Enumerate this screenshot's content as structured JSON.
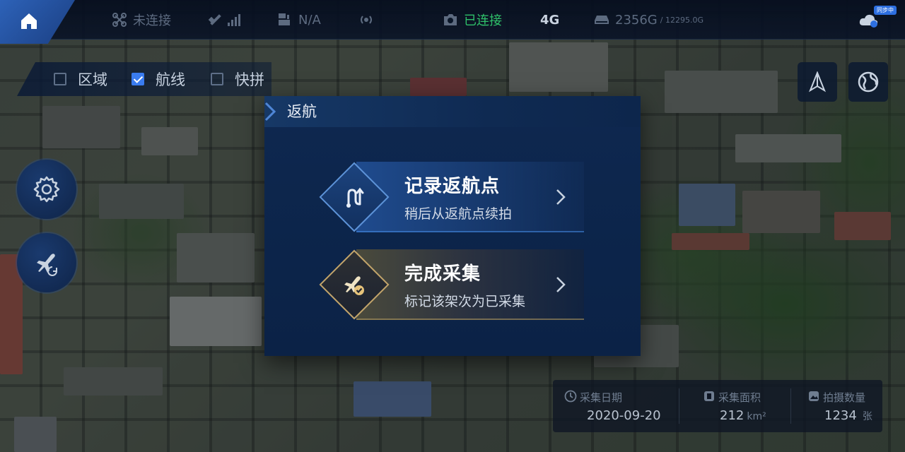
{
  "topbar": {
    "drone_status": "未连接",
    "rtk_status": "N/A",
    "camera_status": "已连接",
    "network": "4G",
    "storage_used": "2356G",
    "storage_total": "/ 12295.0G",
    "sync_badge": "同步中"
  },
  "layers": [
    {
      "label": "区域",
      "checked": false
    },
    {
      "label": "航线",
      "checked": true
    },
    {
      "label": "快拼",
      "checked": false
    }
  ],
  "dialog": {
    "title": "返航",
    "options": [
      {
        "title": "记录返航点",
        "subtitle": "稍后从返航点续拍",
        "icon": "route-return-icon"
      },
      {
        "title": "完成采集",
        "subtitle": "标记该架次为已采集",
        "icon": "plane-check-icon"
      }
    ]
  },
  "stats": [
    {
      "label": "采集日期",
      "value": "2020-09-20",
      "unit": "",
      "icon": "clock-icon"
    },
    {
      "label": "采集面积",
      "value": "212",
      "unit": "km²",
      "icon": "area-icon"
    },
    {
      "label": "拍摄数量",
      "value": "1234",
      "unit": "张",
      "icon": "photo-icon"
    }
  ],
  "colors": {
    "accent": "#3a7cf0",
    "connected": "#2fc16a",
    "dialog_bg": "#0e2850",
    "gold_border": "#c2a46a"
  }
}
